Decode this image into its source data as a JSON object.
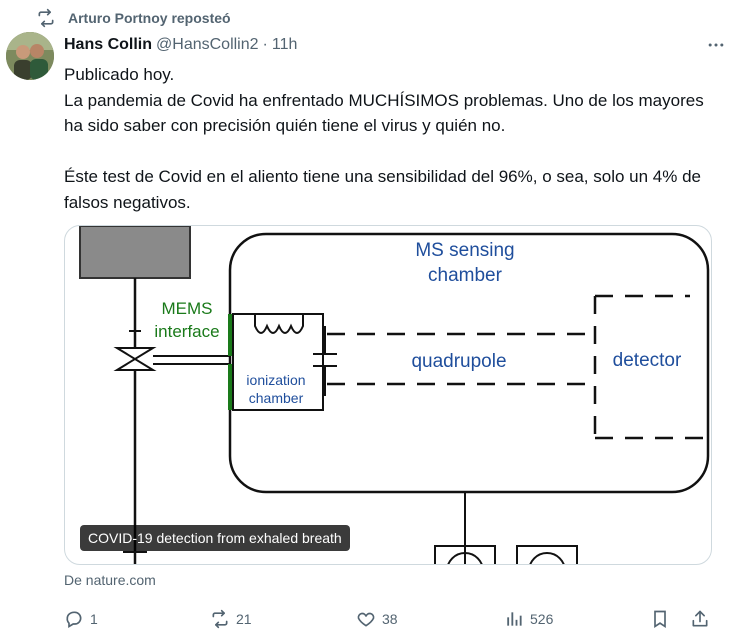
{
  "repost_banner": {
    "text": "Arturo Portnoy reposteó",
    "icon": "repost-icon"
  },
  "author": {
    "name": "Hans Collin",
    "handle": "@HansCollin2",
    "separator": "·",
    "time": "11h"
  },
  "tweet": {
    "line1": "Publicado hoy.",
    "line2": "La pandemia de Covid ha enfrentado MUCHÍSIMOS problemas. Uno de los mayores ha sido saber con precisión quién tiene el virus y quién no.",
    "line3": "Éste test de Covid en el aliento tiene una sensibilidad del 96%, o sea, solo un 4% de falsos negativos."
  },
  "media": {
    "caption": "COVID-19 detection from exhaled breath",
    "diagram": {
      "ms_label_1": "MS sensing",
      "ms_label_2": "chamber",
      "mems_1": "MEMS",
      "mems_2": "interface",
      "ion_1": "ionization",
      "ion_2": "chamber",
      "quad": "quadrupole",
      "detector": "detector"
    }
  },
  "source": "De nature.com",
  "actions": {
    "reply_count": "1",
    "repost_count": "21",
    "like_count": "38",
    "views_count": "526"
  },
  "colors": {
    "secondary_text": "#536471",
    "diagram_blue": "#1f4e9c",
    "diagram_green": "#1a7a1a",
    "border": "#cfd9de"
  }
}
